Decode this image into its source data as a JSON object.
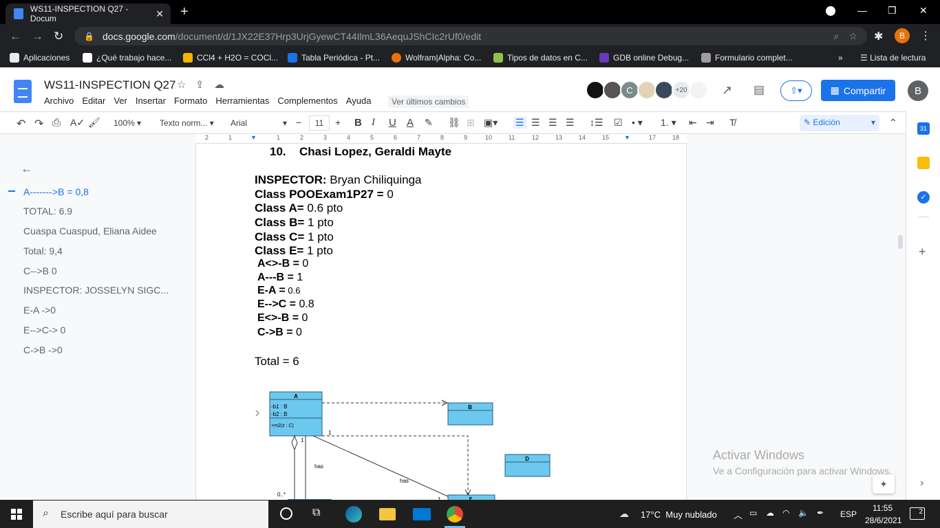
{
  "browser": {
    "tab_title": "WS11-INSPECTION Q27 - Docum",
    "url_host": "docs.google.com",
    "url_path": "/document/d/1JX22E37Hrp3UrjGyewCT44IlmL36AequJShCIc2rUf0/edit",
    "profile_initial": "B",
    "bookmarks": [
      "Aplicaciones",
      "¿Qué trabajo hace...",
      "CCl4 + H2O = COCl...",
      "Tabla Periódica - Pt...",
      "Wolfram|Alpha: Co...",
      "Tipos de datos en C...",
      "GDB online Debug...",
      "Formulario complet..."
    ],
    "reading_list": "Lista de lectura",
    "more": "»"
  },
  "docs": {
    "title": "WS11-INSPECTION Q27",
    "menu": [
      "Archivo",
      "Editar",
      "Ver",
      "Insertar",
      "Formato",
      "Herramientas",
      "Complementos",
      "Ayuda"
    ],
    "last_edit": "Ver últimos cambios",
    "collab_count": "+20",
    "collab_c": "C",
    "share_label": "Compartir",
    "account_initial": "B",
    "toolbar": {
      "zoom": "100%",
      "style": "Texto norm...",
      "font": "Arial",
      "font_size": "11",
      "mode": "Edición"
    },
    "ruler_marks": [
      "2",
      "1",
      "1",
      "2",
      "3",
      "4",
      "5",
      "6",
      "7",
      "8",
      "9",
      "10",
      "11",
      "12",
      "13",
      "14",
      "15",
      "16",
      "17",
      "18"
    ]
  },
  "outline": {
    "items": [
      "A------->B = 0,8",
      "TOTAL: 6.9",
      "Cuaspa Cuaspud, Eliana Aidee",
      "Total: 9,4",
      "C-->B 0",
      "INSPECTOR: JOSSELYN SIGC...",
      "E-A ->0",
      "E-->C-> 0",
      "C->B ->0"
    ]
  },
  "document": {
    "heading_num": "10.",
    "heading_name": "Chasi Lopez, Geraldi Mayte",
    "lines": [
      {
        "label": "INSPECTOR:",
        "value": " Bryan Chiliquinga"
      },
      {
        "label": "Class POOExam1P27 =",
        "value": " 0"
      },
      {
        "label": "Class A=",
        "value": " 0.6 pto"
      },
      {
        "label": "Class B=",
        "value": " 1 pto"
      },
      {
        "label": "Class C=",
        "value": " 1 pto"
      },
      {
        "label": "Class E=",
        "value": " 1 pto"
      },
      {
        "label": "A<>-B =",
        "value": " 0"
      },
      {
        "label": "A---B =",
        "value": " 1"
      },
      {
        "label": "E-A =",
        "value": " 0.6"
      },
      {
        "label": "E-->C =",
        "value": " 0.8"
      },
      {
        "label": "E<>-B =",
        "value": " 0"
      },
      {
        "label": "C->B =",
        "value": " 0"
      }
    ],
    "total": "Total = 6",
    "diagram": {
      "class_a": "A",
      "a_attr1": "-b1 : B",
      "a_attr2": "-b2 : B",
      "a_method": "+m2(z : C)",
      "class_b": "B",
      "class_d": "D",
      "class_e": "E",
      "label_has1": "has",
      "label_has2": "has",
      "mult_1a": "1",
      "mult_1b": "1",
      "mult_1c": "1",
      "mult_0n": "0..*"
    }
  },
  "watermark": {
    "title": "Activar Windows",
    "subtitle": "Ve a Configuración para activar Windows."
  },
  "taskbar": {
    "search_placeholder": "Escribe aquí para buscar",
    "weather": "17°C  Muy nublado",
    "lang": "ESP",
    "time": "11:55",
    "date": "28/6/2021",
    "notif_count": "2"
  },
  "colors": {
    "uml_fill": "#6cc8ee",
    "accent": "#1a73e8"
  }
}
